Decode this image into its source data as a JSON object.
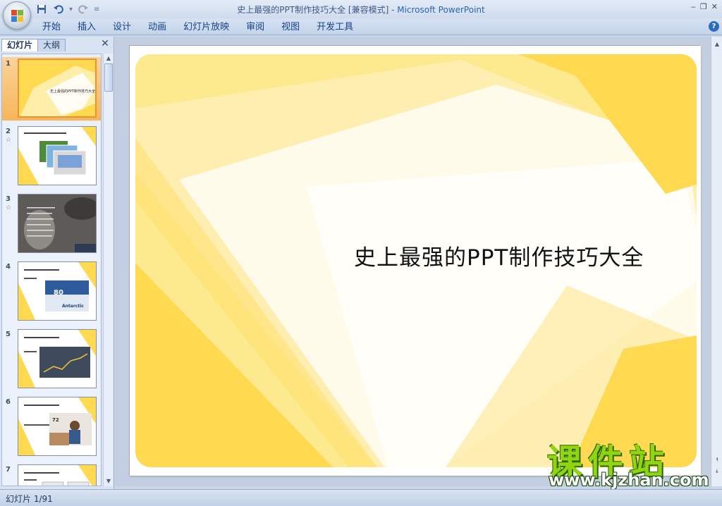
{
  "window": {
    "title": "史上最强的PPT制作技巧大全 [兼容模式]",
    "separator": " - ",
    "app_name": "Microsoft PowerPoint"
  },
  "quick_access": {
    "customize_symbol": "≡"
  },
  "ribbon": {
    "tabs": [
      "开始",
      "插入",
      "设计",
      "动画",
      "幻灯片放映",
      "审阅",
      "视图",
      "开发工具"
    ],
    "help_label": "?"
  },
  "left_pane": {
    "tabs": [
      "幻灯片",
      "大纲"
    ],
    "close_symbol": "✕",
    "thumbnails": [
      {
        "number": "1",
        "star": ""
      },
      {
        "number": "2",
        "star": "☆"
      },
      {
        "number": "3",
        "star": "☆"
      },
      {
        "number": "4",
        "star": ""
      },
      {
        "number": "5",
        "star": ""
      },
      {
        "number": "6",
        "star": ""
      },
      {
        "number": "7",
        "star": ""
      }
    ]
  },
  "slide": {
    "title": "史上最强的PPT制作技巧大全"
  },
  "watermark": {
    "main": "课件站",
    "url": "www.kjzhan.com"
  },
  "status_bar": {
    "slide_info": "幻灯片 1/91"
  },
  "colors": {
    "accent_yellow": "#ffd94f",
    "light_yellow": "#fdeea9",
    "selection_orange": "#f7b559",
    "ribbon_text": "#15428b"
  }
}
